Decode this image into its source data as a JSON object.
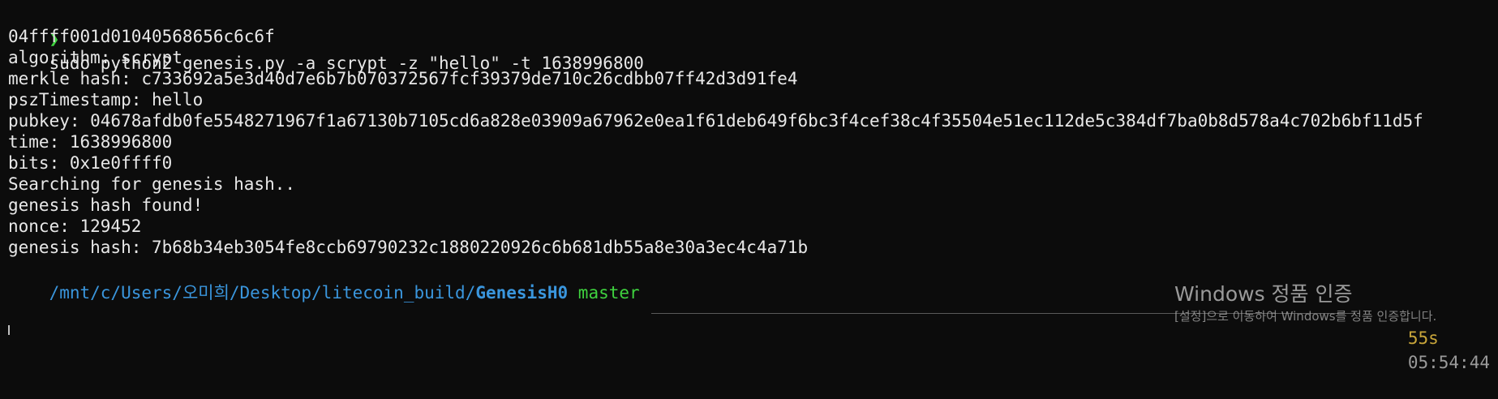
{
  "terminal": {
    "prompt_symbol": "❯",
    "command": "sudo python2 genesis.py -a scrypt -z \"hello\" -t 1638996800",
    "output": [
      "04ffff001d01040568656c6c6f",
      "algorithm: scrypt",
      "merkle hash: c733692a5e3d40d7e6b7b070372567fcf39379de710c26cdbb07ff42d3d91fe4",
      "pszTimestamp: hello",
      "pubkey: 04678afdb0fe5548271967f1a67130b7105cd6a828e03909a67962e0ea1f61deb649f6bc3f4cef38c4f35504e51ec112de5c384df7ba0b8d578a4c702b6bf11d5f",
      "time: 1638996800",
      "bits: 0x1e0ffff0",
      "Searching for genesis hash..",
      "genesis hash found!",
      "nonce: 129452",
      "genesis hash: 7b68b34eb3054fe8ccb69790232c1880220926c6b681db55a8e30a3ec4c4a71b"
    ],
    "path_prefix": "/mnt/c/Users/오미희/Desktop/litecoin_build/",
    "path_current": "GenesisH0",
    "git_branch": "master",
    "duration": "55s",
    "clock": "05:54:44"
  },
  "watermark": {
    "title": "Windows 정품 인증",
    "subtitle": "[설정]으로 이동하여 Windows를 정품 인증합니다."
  },
  "colors": {
    "background": "#0c0c0c",
    "text": "#e8e8e8",
    "prompt_green": "#3fd23f",
    "path_blue": "#3a96dd",
    "duration_yellow": "#c8a53a"
  }
}
